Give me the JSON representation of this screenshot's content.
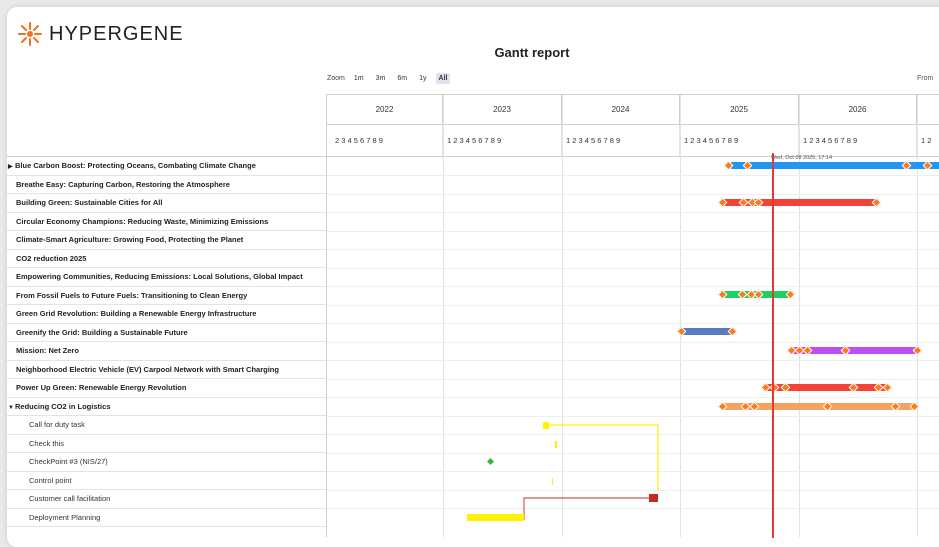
{
  "brand": {
    "name": "HYPERGENE",
    "color": "#f36f21"
  },
  "report": {
    "title": "Gantt report"
  },
  "zoom": {
    "label": "Zoom",
    "options": [
      {
        "label": "1m",
        "active": false
      },
      {
        "label": "3m",
        "active": false
      },
      {
        "label": "6m",
        "active": false
      },
      {
        "label": "1y",
        "active": false
      },
      {
        "label": "All",
        "active": true
      }
    ]
  },
  "range": {
    "from_label": "From"
  },
  "timeline": {
    "years": [
      "2022",
      "2023",
      "2024",
      "2025",
      "2026"
    ],
    "year_2022_months": "2 3 4 5 6 7 8 9",
    "year_full_months": "1 2 3 4 5 6 7 8 9",
    "trailing_months": "1 2"
  },
  "today": {
    "label": "Wed, Oct 08 2025, 17:14",
    "color": "#e53935"
  },
  "rows": [
    {
      "label": "Blue Carbon Boost: Protecting Oceans, Combating Climate Change",
      "type": "project",
      "toggle": "▶"
    },
    {
      "label": "Breathe Easy: Capturing Carbon, Restoring the Atmosphere",
      "type": "project",
      "toggle": ""
    },
    {
      "label": "Building Green: Sustainable Cities for All",
      "type": "project",
      "toggle": ""
    },
    {
      "label": "Circular Economy Champions: Reducing Waste, Minimizing Emissions",
      "type": "project",
      "toggle": ""
    },
    {
      "label": "Climate-Smart Agriculture: Growing Food, Protecting the Planet",
      "type": "project",
      "toggle": ""
    },
    {
      "label": "CO2 reduction 2025",
      "type": "project",
      "toggle": ""
    },
    {
      "label": "Empowering Communities, Reducing Emissions: Local Solutions, Global Impact",
      "type": "project",
      "toggle": ""
    },
    {
      "label": "From Fossil Fuels to Future Fuels: Transitioning to Clean Energy",
      "type": "project",
      "toggle": ""
    },
    {
      "label": "Green Grid Revolution: Building a Renewable Energy Infrastructure",
      "type": "project",
      "toggle": ""
    },
    {
      "label": "Greenify the Grid: Building a Sustainable Future",
      "type": "project",
      "toggle": ""
    },
    {
      "label": "Mission: Net Zero",
      "type": "project",
      "toggle": ""
    },
    {
      "label": "Neighborhood Electric Vehicle (EV) Carpool Network with Smart Charging",
      "type": "project",
      "toggle": ""
    },
    {
      "label": "Power Up Green: Renewable Energy Revolution",
      "type": "project",
      "toggle": ""
    },
    {
      "label": "Reducing CO2 in Logistics",
      "type": "project",
      "toggle": "▼"
    },
    {
      "label": "Call for duty task",
      "type": "task",
      "toggle": ""
    },
    {
      "label": "Check this",
      "type": "task",
      "toggle": ""
    },
    {
      "label": "CheckPoint #3 (NIS/27)",
      "type": "task",
      "toggle": ""
    },
    {
      "label": "Control point",
      "type": "task",
      "toggle": ""
    },
    {
      "label": "Customer call facilitation",
      "type": "task",
      "toggle": ""
    },
    {
      "label": "Deployment Planning",
      "type": "task",
      "toggle": ""
    }
  ],
  "bar_colors": {
    "blue": "#2196f3",
    "red": "#f44336",
    "green": "#1fd162",
    "slate": "#5b7bbf",
    "purple": "#c14df0",
    "orange": "#f4a261",
    "yellow": "#fff200",
    "dark_red": "#c62828",
    "milestone": "#ff7a1a",
    "checkpoint": "#3bb54a"
  }
}
